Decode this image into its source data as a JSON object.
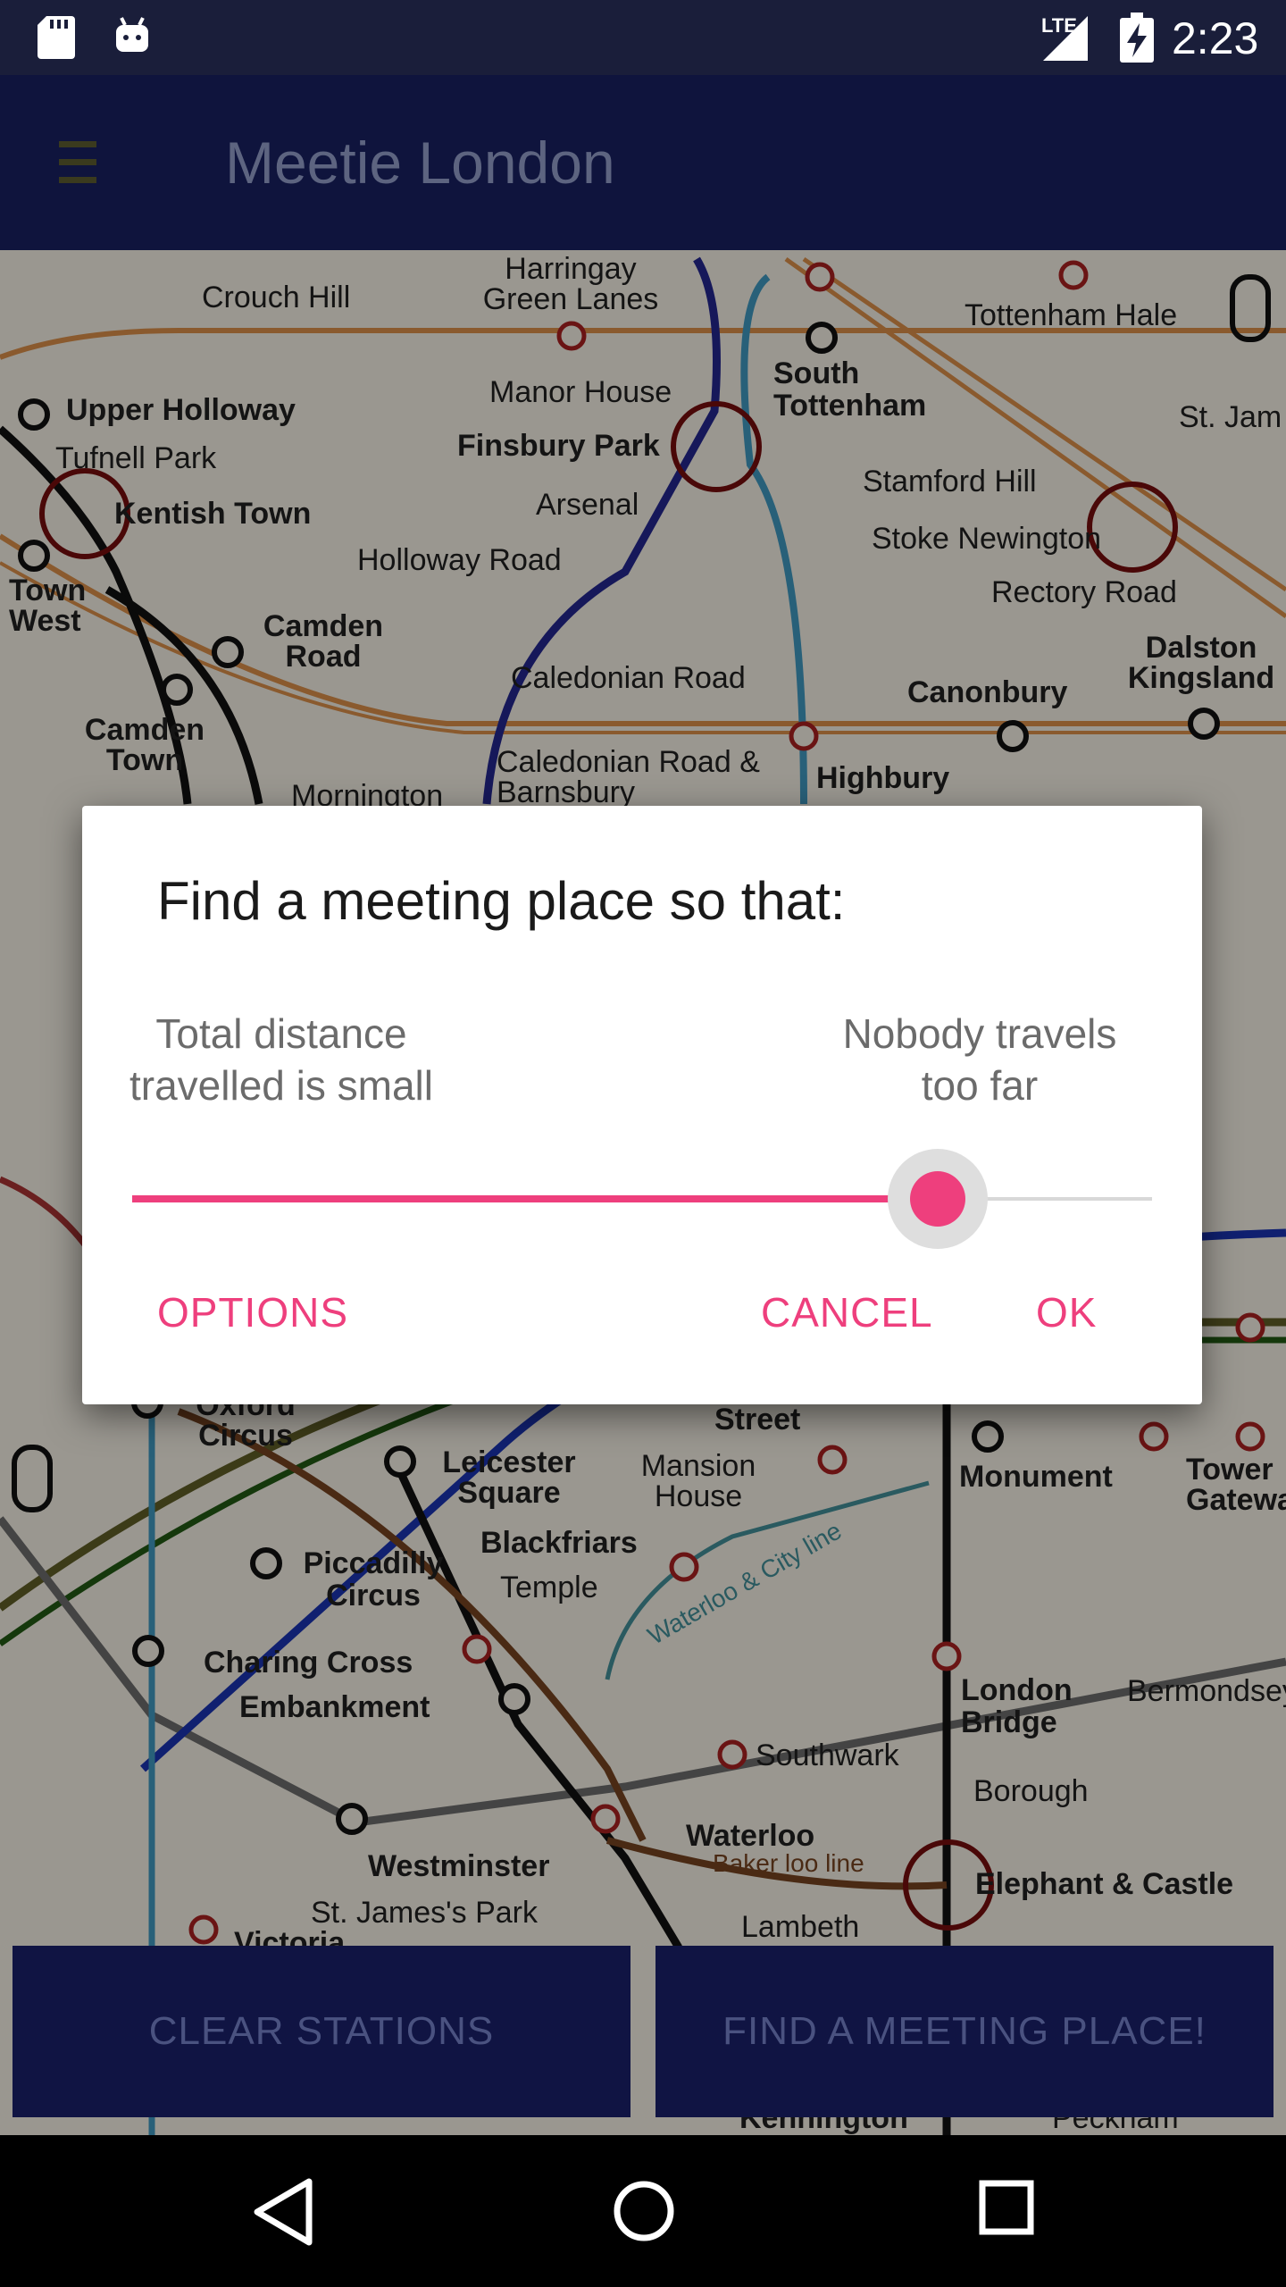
{
  "status_bar": {
    "network_label": "LTE",
    "time": "2:23",
    "icons": [
      "sd-card-icon",
      "android-icon",
      "signal-icon",
      "battery-charging-icon"
    ]
  },
  "app_bar": {
    "title": "Meetie London",
    "menu_icon": "hamburger-menu-icon"
  },
  "map": {
    "stations": [
      "Crouch Hill",
      "Harringay Green Lanes",
      "South Tottenham",
      "Tottenham Hale",
      "Upper Holloway",
      "Manor House",
      "Tufnell Park",
      "Finsbury Park",
      "St. Jam",
      "Kentish Town",
      "Arsenal",
      "Stamford Hill",
      "Stoke Newington",
      "Holloway Road",
      "Town West",
      "Rectory Road",
      "Camden Road",
      "Dalston Kingsland",
      "Caledonian Road",
      "Canonbury",
      "Camden Town",
      "Caledonian Road & Barnsbury",
      "Highbury",
      "Mornington",
      "Oxford Circus",
      "Leicester Square",
      "Mansion House",
      "Monument",
      "Tower Gateway",
      "Piccadilly Circus",
      "Blackfriars",
      "Temple",
      "Charing Cross",
      "Embankment",
      "London Bridge",
      "Bermondsey",
      "Southwark",
      "Borough",
      "Waterloo",
      "Westminster",
      "St. James's Park",
      "Baker loo line",
      "Elephant & Castle",
      "Lambeth",
      "Victoria",
      "Kennington",
      "Peckham",
      "Street",
      "Waterloo & City line"
    ]
  },
  "dialog": {
    "title": "Find a meeting place so that:",
    "left_label_line1": "Total distance",
    "left_label_line2": "travelled is small",
    "right_label_line1": "Nobody travels",
    "right_label_line2": "too far",
    "slider_value": 0.79,
    "options_label": "OPTIONS",
    "cancel_label": "CANCEL",
    "ok_label": "OK",
    "accent_color": "#ee3f7d"
  },
  "bottom_buttons": {
    "clear_label": "CLEAR STATIONS",
    "find_label": "FIND A MEETING PLACE!"
  },
  "nav_bar": {
    "icons": [
      "back-icon",
      "home-icon",
      "recents-icon"
    ]
  }
}
